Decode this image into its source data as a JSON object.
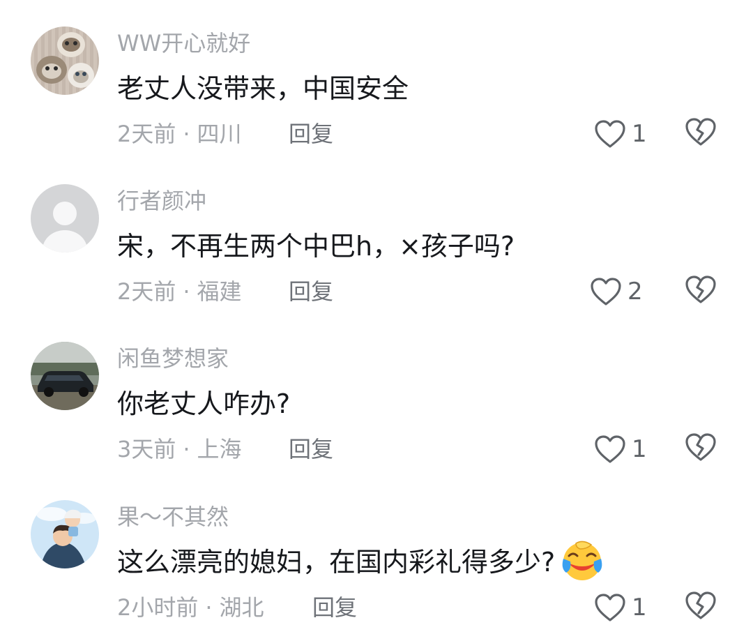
{
  "comments": [
    {
      "username": "WW开心就好",
      "text": "老丈人没带来，中国安全",
      "time": "2天前",
      "location": "四川",
      "reply_label": "回复",
      "likes": "1",
      "avatar_icon": "cats-photo-avatar"
    },
    {
      "username": "行者颜冲",
      "text": "宋，不再生两个中巴h，×孩子吗?",
      "time": "2天前",
      "location": "福建",
      "reply_label": "回复",
      "likes": "2",
      "avatar_icon": "default-user-avatar"
    },
    {
      "username": "闲鱼梦想家",
      "text": "你老丈人咋办?",
      "time": "3天前",
      "location": "上海",
      "reply_label": "回复",
      "likes": "1",
      "avatar_icon": "car-photo-avatar"
    },
    {
      "username": "果～不其然",
      "text": "这么漂亮的媳妇，在国内彩礼得多少?",
      "time": "2小时前",
      "location": "湖北",
      "reply_label": "回复",
      "likes": "1",
      "avatar_icon": "cartoon-father-son-avatar",
      "emoji": "laughing-crying-emoji"
    }
  ],
  "meta_separator": "·",
  "colors": {
    "secondary_text": "#a3a6ab",
    "primary_text": "#16181c",
    "icon": "#5f6368"
  }
}
